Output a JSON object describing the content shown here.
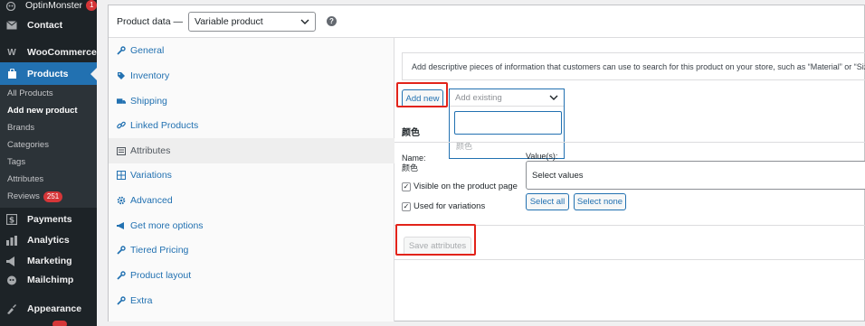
{
  "admin_menu": {
    "items": [
      {
        "label": "OptinMonster",
        "badge": "1",
        "icon": "optinmonster-icon"
      },
      {
        "label": "Contact",
        "icon": "mail-icon"
      },
      {
        "label": "WooCommerce",
        "icon": "woo-icon"
      },
      {
        "label": "Products",
        "icon": "products-icon"
      },
      {
        "label": "Payments",
        "icon": "payments-icon"
      },
      {
        "label": "Analytics",
        "icon": "analytics-icon"
      },
      {
        "label": "Marketing",
        "icon": "marketing-icon"
      },
      {
        "label": "Mailchimp",
        "icon": "mailchimp-icon"
      },
      {
        "label": "Appearance",
        "icon": "appearance-icon"
      }
    ],
    "submenu": [
      {
        "label": "All Products"
      },
      {
        "label": "Add new product"
      },
      {
        "label": "Brands"
      },
      {
        "label": "Categories"
      },
      {
        "label": "Tags"
      },
      {
        "label": "Attributes"
      },
      {
        "label": "Reviews",
        "badge": "251"
      }
    ]
  },
  "product_data": {
    "title": "Product data —",
    "type_select": "Variable product",
    "help": "?",
    "tabs": [
      {
        "label": "General",
        "icon": "wrench-icon"
      },
      {
        "label": "Inventory",
        "icon": "tag-icon"
      },
      {
        "label": "Shipping",
        "icon": "truck-icon"
      },
      {
        "label": "Linked Products",
        "icon": "link-icon"
      },
      {
        "label": "Attributes",
        "icon": "list-icon"
      },
      {
        "label": "Variations",
        "icon": "grid-icon"
      },
      {
        "label": "Advanced",
        "icon": "gear-icon"
      },
      {
        "label": "Get more options",
        "icon": "megaphone-icon"
      },
      {
        "label": "Tiered Pricing",
        "icon": "wrench-icon"
      },
      {
        "label": "Product layout",
        "icon": "wrench-icon"
      },
      {
        "label": "Extra",
        "icon": "wrench-icon"
      }
    ]
  },
  "attributes": {
    "notice": "Add descriptive pieces of information that customers can use to search for this product on your store, such as “Material” or “Size”.",
    "add_new": "Add new",
    "add_existing_placeholder": "Add existing",
    "existing_option": "颜色",
    "attribute_heading": "颜色",
    "name_label": "Name:",
    "name_value": "颜色",
    "values_label": "Value(s):",
    "values_placeholder": "Select values",
    "visible_label": "Visible on the product page",
    "variations_label": "Used for variations",
    "select_all": "Select all",
    "select_none": "Select none",
    "save": "Save attributes"
  },
  "colors": {
    "accent": "#2271b1",
    "highlight": "#e2231a",
    "sidebar_bg": "#1d2327"
  }
}
